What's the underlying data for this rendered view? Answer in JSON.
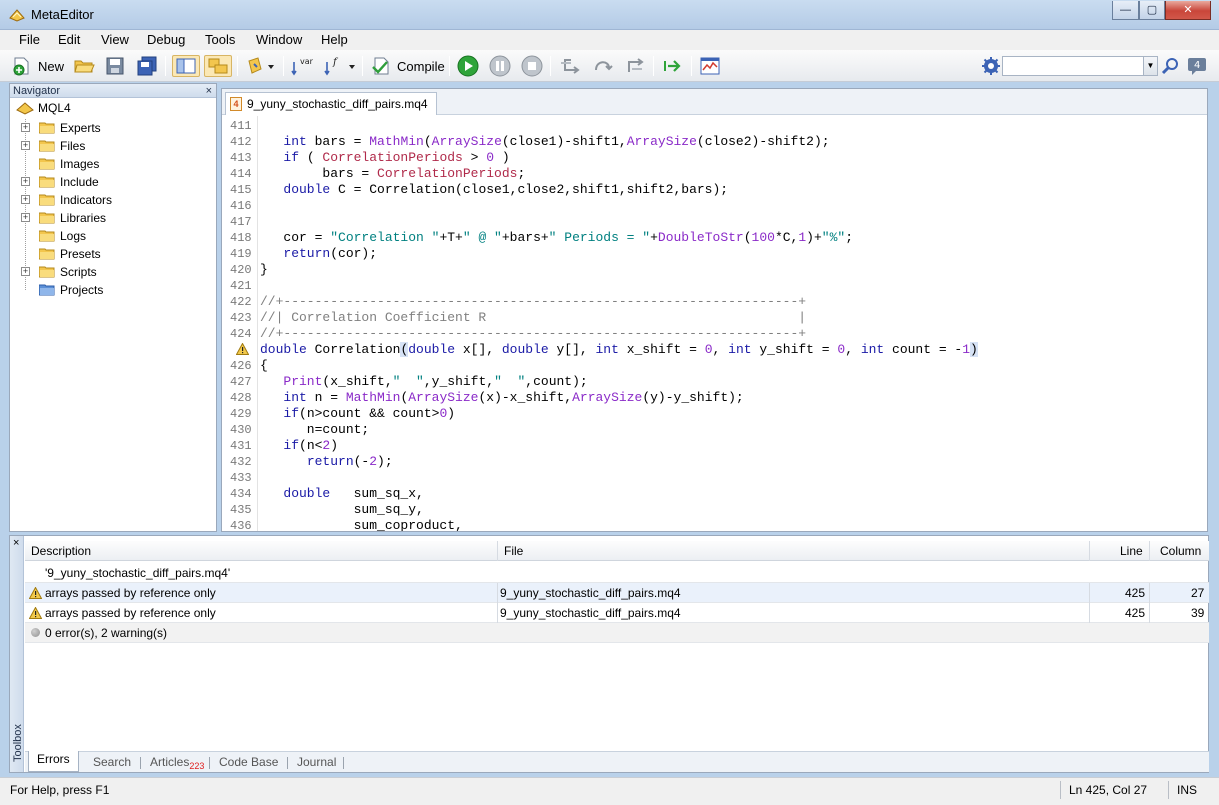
{
  "window": {
    "title": "MetaEditor",
    "minimize": "—",
    "maximize": "▢",
    "close": "✕"
  },
  "menu": [
    "File",
    "Edit",
    "View",
    "Debug",
    "Tools",
    "Window",
    "Help"
  ],
  "toolbar": {
    "new_label": "New",
    "compile_label": "Compile",
    "search_value": ""
  },
  "navigator": {
    "title": "Navigator",
    "close": "×",
    "root": "MQL4",
    "items": [
      {
        "label": "Experts",
        "expandable": true
      },
      {
        "label": "Files",
        "expandable": true
      },
      {
        "label": "Images",
        "expandable": false
      },
      {
        "label": "Include",
        "expandable": true
      },
      {
        "label": "Indicators",
        "expandable": true
      },
      {
        "label": "Libraries",
        "expandable": true
      },
      {
        "label": "Logs",
        "expandable": false
      },
      {
        "label": "Presets",
        "expandable": false
      },
      {
        "label": "Scripts",
        "expandable": true
      },
      {
        "label": "Projects",
        "expandable": false
      }
    ]
  },
  "editor": {
    "tab_icon": "4",
    "tab_label": "9_yuny_stochastic_diff_pairs.mq4",
    "lines": [
      {
        "n": "411",
        "code": ""
      },
      {
        "n": "412",
        "code": "   int bars = MathMin(ArraySize(close1)-shift1,ArraySize(close2)-shift2);"
      },
      {
        "n": "413",
        "code": "   if ( CorrelationPeriods > 0 )"
      },
      {
        "n": "414",
        "code": "        bars = CorrelationPeriods;"
      },
      {
        "n": "415",
        "code": "   double C = Correlation(close1,close2,shift1,shift2,bars);"
      },
      {
        "n": "416",
        "code": ""
      },
      {
        "n": "417",
        "code": ""
      },
      {
        "n": "418",
        "code": "   cor = \"Correlation \"+T+\" @ \"+bars+\" Periods = \"+DoubleToStr(100*C,1)+\"%\";"
      },
      {
        "n": "419",
        "code": "   return(cor);"
      },
      {
        "n": "420",
        "code": "}"
      },
      {
        "n": "421",
        "code": ""
      },
      {
        "n": "422",
        "code": "//+------------------------------------------------------------------+"
      },
      {
        "n": "423",
        "code": "//| Correlation Coefficient R                                        |"
      },
      {
        "n": "424",
        "code": "//+------------------------------------------------------------------+"
      },
      {
        "n": "",
        "code": "double Correlation(double x[], double y[], int x_shift = 0, int y_shift = 0, int count = -1)",
        "warning": true
      },
      {
        "n": "426",
        "code": "{"
      },
      {
        "n": "427",
        "code": "   Print(x_shift,\"  \",y_shift,\"  \",count);"
      },
      {
        "n": "428",
        "code": "   int n = MathMin(ArraySize(x)-x_shift,ArraySize(y)-y_shift);"
      },
      {
        "n": "429",
        "code": "   if(n>count && count>0)"
      },
      {
        "n": "430",
        "code": "      n=count;"
      },
      {
        "n": "431",
        "code": "   if(n<2)"
      },
      {
        "n": "432",
        "code": "      return(-2);"
      },
      {
        "n": "433",
        "code": ""
      },
      {
        "n": "434",
        "code": "   double   sum_sq_x,"
      },
      {
        "n": "435",
        "code": "            sum_sq_y,"
      },
      {
        "n": "436",
        "code": "            sum_coproduct,"
      }
    ]
  },
  "toolbox": {
    "label": "Toolbox",
    "close": "×",
    "columns": {
      "description": "Description",
      "file": "File",
      "line": "Line",
      "column": "Column"
    },
    "rows": [
      {
        "type": "file",
        "description": "'9_yuny_stochastic_diff_pairs.mq4'",
        "file": "",
        "line": "",
        "column": ""
      },
      {
        "type": "warning",
        "description": "arrays passed by reference only",
        "file": "9_yuny_stochastic_diff_pairs.mq4",
        "line": "425",
        "column": "27"
      },
      {
        "type": "warning",
        "description": "arrays passed by reference only",
        "file": "9_yuny_stochastic_diff_pairs.mq4",
        "line": "425",
        "column": "39"
      },
      {
        "type": "summary",
        "description": "0 error(s), 2 warning(s)",
        "file": "",
        "line": "",
        "column": ""
      }
    ],
    "tabs": [
      {
        "label": "Errors",
        "active": true
      },
      {
        "label": "Search"
      },
      {
        "label": "Articles",
        "badge": "223"
      },
      {
        "label": "Code Base"
      },
      {
        "label": "Journal"
      }
    ]
  },
  "status": {
    "help": "For Help, press F1",
    "position": "Ln 425, Col 27",
    "mode": "INS"
  },
  "colors": {
    "accent": "#b9d1ea",
    "keyword": "#1a1aa6",
    "function": "#8a2ac8",
    "string": "#008080",
    "comment": "#808080"
  }
}
